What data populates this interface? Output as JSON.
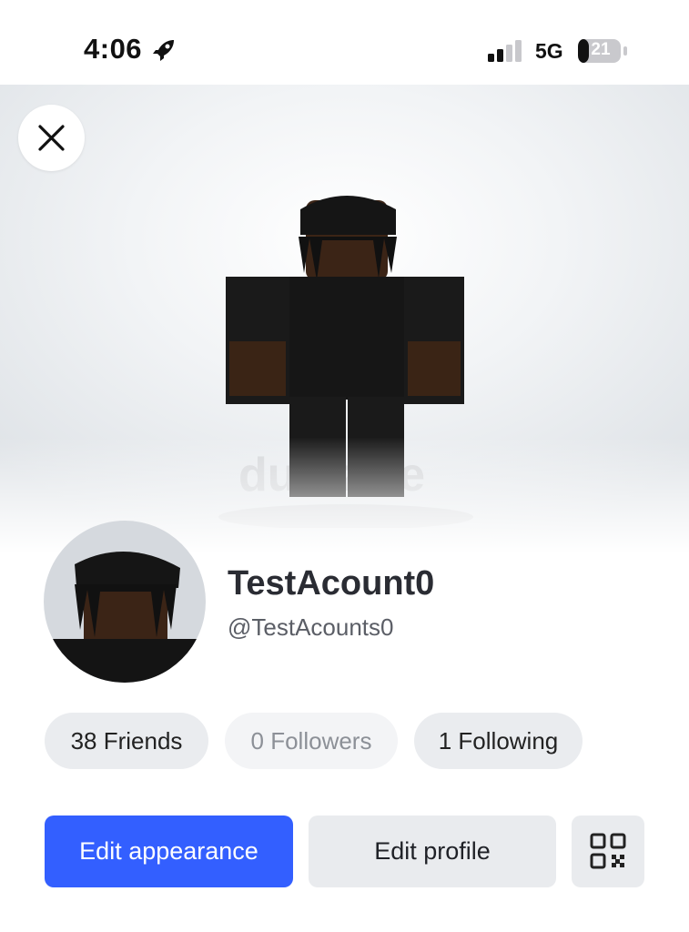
{
  "status_bar": {
    "time": "4:06",
    "network": "5G",
    "battery_level": "21"
  },
  "profile": {
    "display_name": "TestAcount0",
    "username": "@TestAcounts0"
  },
  "stats": {
    "friends": "38 Friends",
    "followers": "0 Followers",
    "following": "1 Following"
  },
  "actions": {
    "edit_appearance": "Edit appearance",
    "edit_profile": "Edit profile"
  },
  "icons": {
    "close": "close-icon",
    "qr": "qr-code-icon",
    "rocket": "rocket-icon"
  },
  "colors": {
    "primary": "#335fff",
    "pill_bg": "#eaecef",
    "muted_text": "#8c9097"
  }
}
